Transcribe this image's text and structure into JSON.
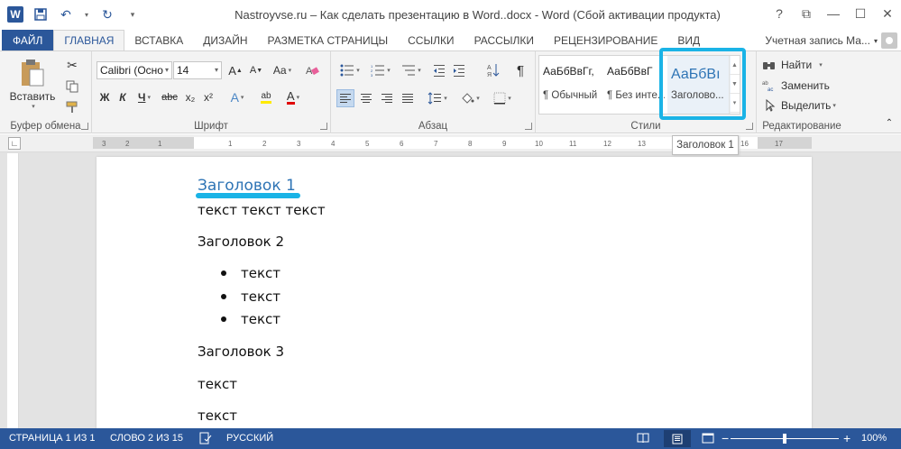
{
  "titlebar": {
    "title": "Nastroyvse.ru – Как сделать презентацию в Word..docx - Word (Сбой активации продукта)",
    "logo_letter": "W",
    "help": "?",
    "ribbon_opts": "⧉",
    "minimize": "—",
    "maximize": "☐",
    "close": "✕"
  },
  "tabs": {
    "file": "ФАЙЛ",
    "items": [
      "ГЛАВНАЯ",
      "ВСТАВКА",
      "ДИЗАЙН",
      "РАЗМЕТКА СТРАНИЦЫ",
      "ССЫЛКИ",
      "РАССЫЛКИ",
      "РЕЦЕНЗИРОВАНИЕ",
      "ВИД"
    ],
    "active_index": 0,
    "account": "Учетная запись Ма..."
  },
  "clipboard": {
    "paste": "Вставить",
    "label": "Буфер обмена"
  },
  "font": {
    "name": "Calibri (Осно",
    "size": "14",
    "grow": "A",
    "shrink": "A",
    "case": "Aa",
    "bold": "Ж",
    "italic": "К",
    "underline": "Ч",
    "strike": "abc",
    "sub": "x₂",
    "sup": "x²",
    "effects": "A",
    "highlight": "ab",
    "color": "A",
    "label": "Шрифт"
  },
  "paragraph": {
    "label": "Абзац",
    "pilcrow": "¶"
  },
  "styles": {
    "label": "Стили",
    "items": [
      {
        "sample": "АаБбВвГг,",
        "name": "¶ Обычный"
      },
      {
        "sample": "АаБбВвГ",
        "name": "¶ Без инте..."
      },
      {
        "sample": "АаБбВı",
        "name": "Заголово..."
      }
    ],
    "selected_index": 2
  },
  "editing": {
    "find": "Найти",
    "replace": "Заменить",
    "select": "Выделить",
    "label": "Редактирование"
  },
  "tooltip": "Заголовок 1",
  "ruler": {
    "ticks": [
      "3",
      "2",
      "1",
      "1",
      "2",
      "3",
      "4",
      "5",
      "6",
      "7",
      "8",
      "9",
      "10",
      "11",
      "12",
      "13",
      "14",
      "15",
      "16",
      "17"
    ]
  },
  "document": {
    "heading1": "Заголовок 1",
    "text1": "текст текст текст",
    "heading2": "Заголовок 2",
    "bullets": [
      "текст",
      "текст",
      "текст"
    ],
    "heading3": "Заголовок 3",
    "text2": "текст",
    "text3": "текст"
  },
  "statusbar": {
    "page": "СТРАНИЦА 1 ИЗ 1",
    "words": "СЛОВО 2 ИЗ 15",
    "language": "РУССКИЙ",
    "zoom": "100%",
    "zoom_minus": "−",
    "zoom_plus": "+"
  },
  "colors": {
    "accent": "#2b579a",
    "heading": "#2e74b5",
    "highlight": "#1ab3e6"
  }
}
